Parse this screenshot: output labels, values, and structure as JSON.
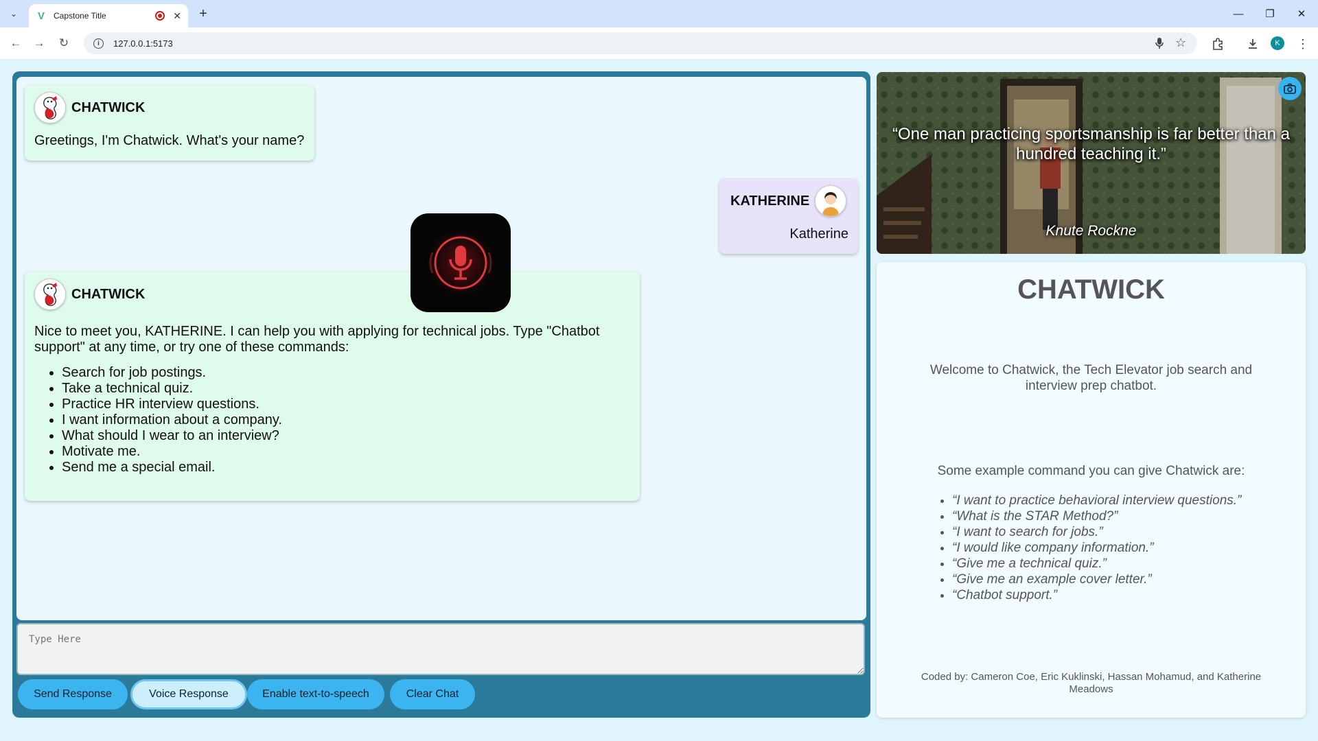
{
  "browser": {
    "tab_title": "Capstone Title",
    "url": "127.0.0.1:5173",
    "profile_initial": "K"
  },
  "messages": [
    {
      "sender": "CHATWICK",
      "type": "bot",
      "text": "Greetings, I'm Chatwick. What's your name?"
    },
    {
      "sender": "KATHERINE",
      "type": "user",
      "text": "Katherine"
    },
    {
      "sender": "CHATWICK",
      "type": "bot",
      "text": "Nice to meet you, KATHERINE. I can help you with applying for technical jobs. Type \"Chatbot support\" at any time, or try one of these commands:",
      "commands": [
        "Search for job postings.",
        "Take a technical quiz.",
        "Practice HR interview questions.",
        "I want information about a company.",
        "What should I wear to an interview?",
        "Motivate me.",
        "Send me a special email."
      ]
    }
  ],
  "input": {
    "placeholder": "Type Here"
  },
  "buttons": {
    "send": "Send Response",
    "voice": "Voice Response",
    "tts": "Enable text-to-speech",
    "clear": "Clear Chat"
  },
  "quote": {
    "text": "“One man practicing sportsmanship is far better than a hundred teaching it.”",
    "author": "Knute Rockne"
  },
  "info": {
    "title": "CHATWICK",
    "welcome": "Welcome to Chatwick, the Tech Elevator job search and interview prep chatbot.",
    "examples_heading": "Some example command you can give Chatwick are:",
    "examples": [
      "“I want to practice behavioral interview questions.”",
      "“What is the STAR Method?”",
      "“I want to search for jobs.”",
      "“I would like company information.”",
      "“Give me a technical quiz.”",
      "“Give me an example cover letter.”",
      "“Chatbot support.”"
    ],
    "credits": "Coded by: Cameron Coe, Eric Kuklinski, Hassan Mohamud, and Katherine Meadows"
  },
  "colors": {
    "panel": "#2b7a99",
    "button": "#3cb4ef",
    "bot_bubble": "#dffbec",
    "user_bubble": "#e9e2fb",
    "mic_red": "#e0393e"
  }
}
